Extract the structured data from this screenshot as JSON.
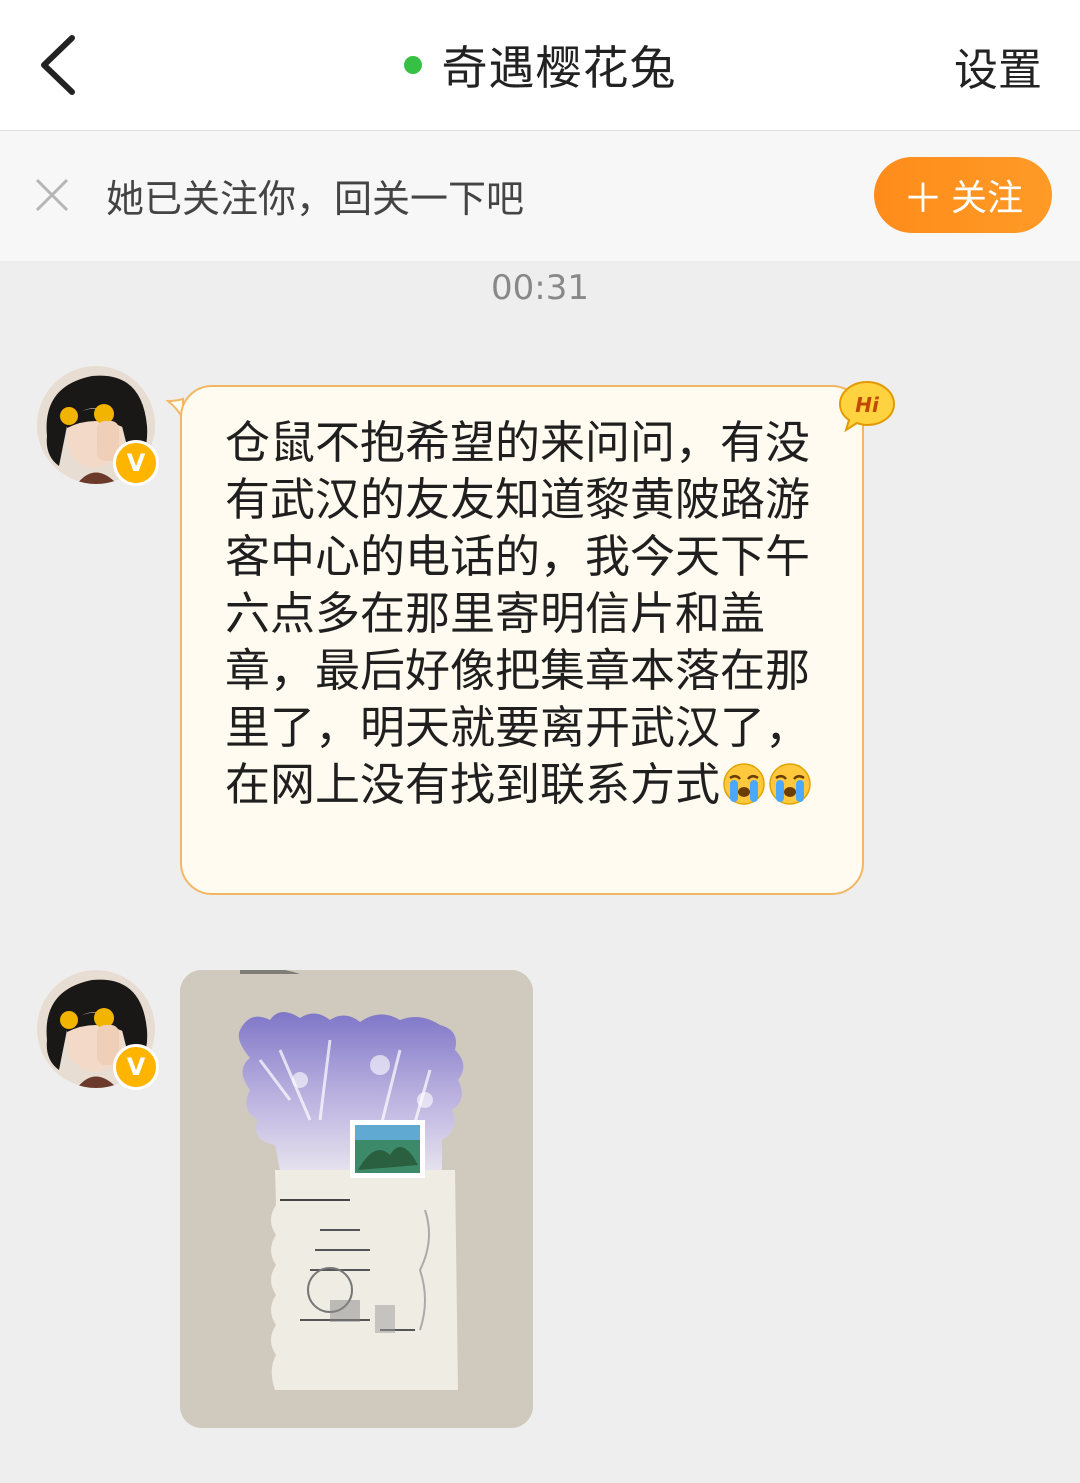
{
  "header": {
    "back_icon": "chevron-left-icon",
    "title": "奇遇樱花兔",
    "online_color": "#36c144",
    "settings_label": "设置"
  },
  "banner": {
    "close_icon": "close-icon",
    "text": "她已关注你，回关一下吧",
    "follow_label": "关注",
    "follow_icon": "plus-icon",
    "accent": "#ff8c1a"
  },
  "chat": {
    "timestamp": "00:31",
    "messages": [
      {
        "type": "text",
        "badge_icon": "verified-v-icon",
        "badge_label": "V",
        "hi_label": "Hi",
        "text": "仓鼠不抱希望的来问问，有没有武汉的友友知道黎黄陂路游客中心的电话的，我今天下午六点多在那里寄明信片和盖章，最后好像把集章本落在那里了，明天就要离开武汉了，在网上没有找到联系方式",
        "emojis": [
          "crying-face-icon",
          "crying-face-icon"
        ]
      },
      {
        "type": "image",
        "badge_label": "V",
        "image_icon": "postcard-photo"
      }
    ]
  }
}
